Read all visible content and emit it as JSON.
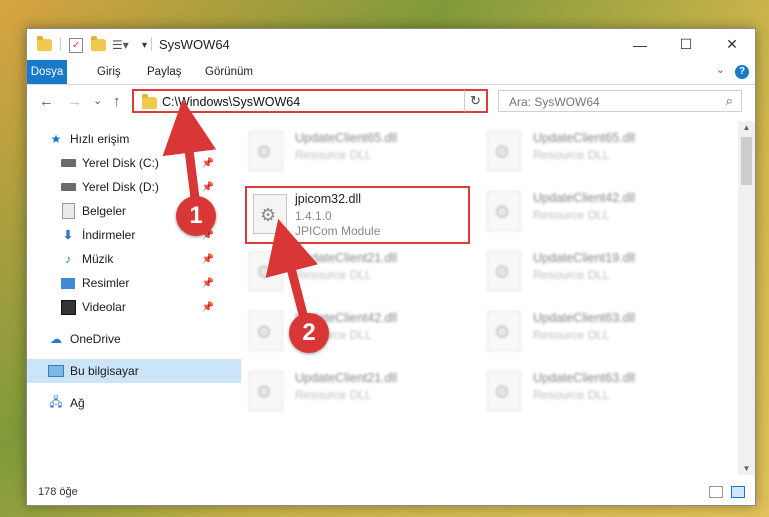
{
  "window": {
    "title": "SysWOW64",
    "controls": {
      "minimize": "—",
      "maximize": "☐",
      "close": "✕"
    }
  },
  "ribbon": {
    "tabs": [
      "Dosya",
      "Giriş",
      "Paylaş",
      "Görünüm"
    ],
    "help": "?"
  },
  "nav": {
    "back": "←",
    "forward": "→",
    "recent": "⌄",
    "up": "↑"
  },
  "address": {
    "path": "C:\\Windows\\SysWOW64",
    "dropdown": "⌄",
    "refresh": "↻"
  },
  "search": {
    "placeholder": "Ara: SysWOW64",
    "icon": "⌕"
  },
  "sidebar": {
    "items": [
      {
        "label": "Hızlı erişim",
        "icon": "star-icon"
      },
      {
        "label": "Yerel Disk (C:)",
        "icon": "drive-icon",
        "pinned": true
      },
      {
        "label": "Yerel Disk (D:)",
        "icon": "drive-icon",
        "pinned": true
      },
      {
        "label": "Belgeler",
        "icon": "document-icon",
        "pinned": true
      },
      {
        "label": "İndirmeler",
        "icon": "download-icon",
        "pinned": true
      },
      {
        "label": "Müzik",
        "icon": "music-icon",
        "pinned": true
      },
      {
        "label": "Resimler",
        "icon": "pictures-icon",
        "pinned": true
      },
      {
        "label": "Videolar",
        "icon": "videos-icon",
        "pinned": true
      },
      {
        "label": "OneDrive",
        "icon": "cloud-icon"
      },
      {
        "label": "Bu bilgisayar",
        "icon": "computer-icon",
        "selected": true
      },
      {
        "label": "Ağ",
        "icon": "network-icon"
      }
    ]
  },
  "files": {
    "highlighted": {
      "name": "jpicom32.dll",
      "version": "1.4.1.0",
      "description": "JPICom Module"
    },
    "blurred": [
      {
        "name": "UpdateClient65.dll",
        "type": "Resource DLL"
      },
      {
        "name": "UpdateClient65.dll",
        "type": "Resource DLL"
      },
      {
        "name": "UpdateClient42.dll",
        "type": "Resource DLL"
      },
      {
        "name": "UpdateClient21.dll",
        "type": "Resource DLL"
      },
      {
        "name": "UpdateClient19.dll",
        "type": "Resource DLL"
      },
      {
        "name": "UpdateClient42.dll",
        "type": "Resource DLL"
      },
      {
        "name": "UpdateClient63.dll",
        "type": "Resource DLL"
      },
      {
        "name": "UpdateClient21.dll",
        "type": "Resource DLL"
      },
      {
        "name": "UpdateClient63.dll",
        "type": "Resource DLL"
      }
    ]
  },
  "status": {
    "count": "178 öğe"
  },
  "callouts": [
    "1",
    "2"
  ],
  "colors": {
    "accent": "#1979ca",
    "highlight": "#e03b3b",
    "badge": "#d93636"
  }
}
